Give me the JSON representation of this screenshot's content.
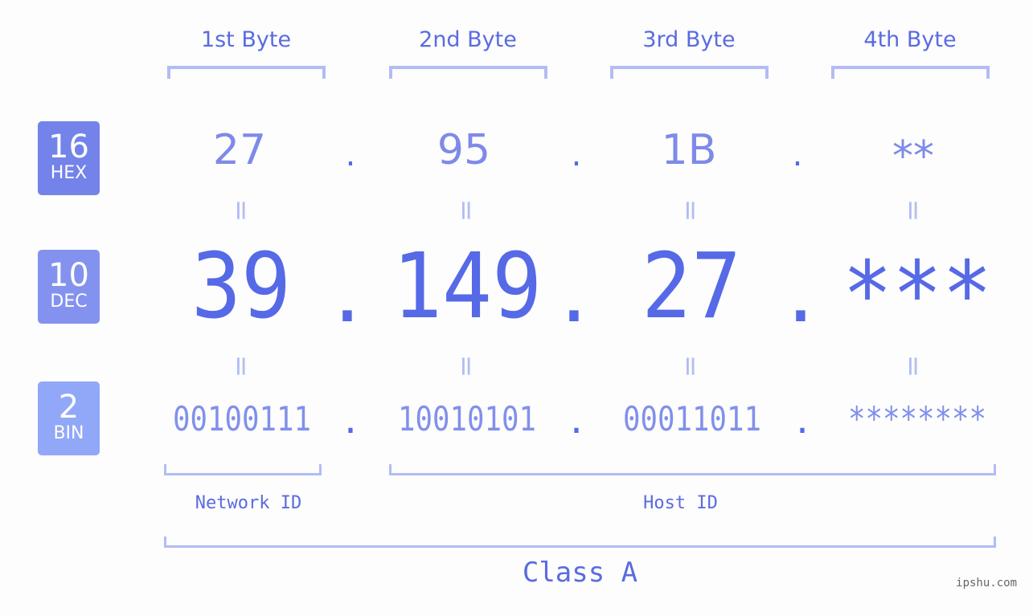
{
  "colors": {
    "hex_badge": "#7383ea",
    "dec_badge": "#8492ef",
    "bin_badge": "#91a7f8",
    "accent": "#5669e6",
    "bracket": "#b3bcf5"
  },
  "badges": [
    {
      "number": "16",
      "label": "HEX"
    },
    {
      "number": "10",
      "label": "DEC"
    },
    {
      "number": "2",
      "label": "BIN"
    }
  ],
  "byte_labels": [
    "1st Byte",
    "2nd Byte",
    "3rd Byte",
    "4th Byte"
  ],
  "hex": [
    "27",
    "95",
    "1B",
    "**"
  ],
  "dec": [
    "39",
    "149",
    "27",
    "***"
  ],
  "bin": [
    "00100111",
    "10010101",
    "00011011",
    "********"
  ],
  "separator": ".",
  "equals": "=",
  "network_id_label": "Network ID",
  "host_id_label": "Host ID",
  "class_label": "Class A",
  "watermark": "ipshu.com"
}
